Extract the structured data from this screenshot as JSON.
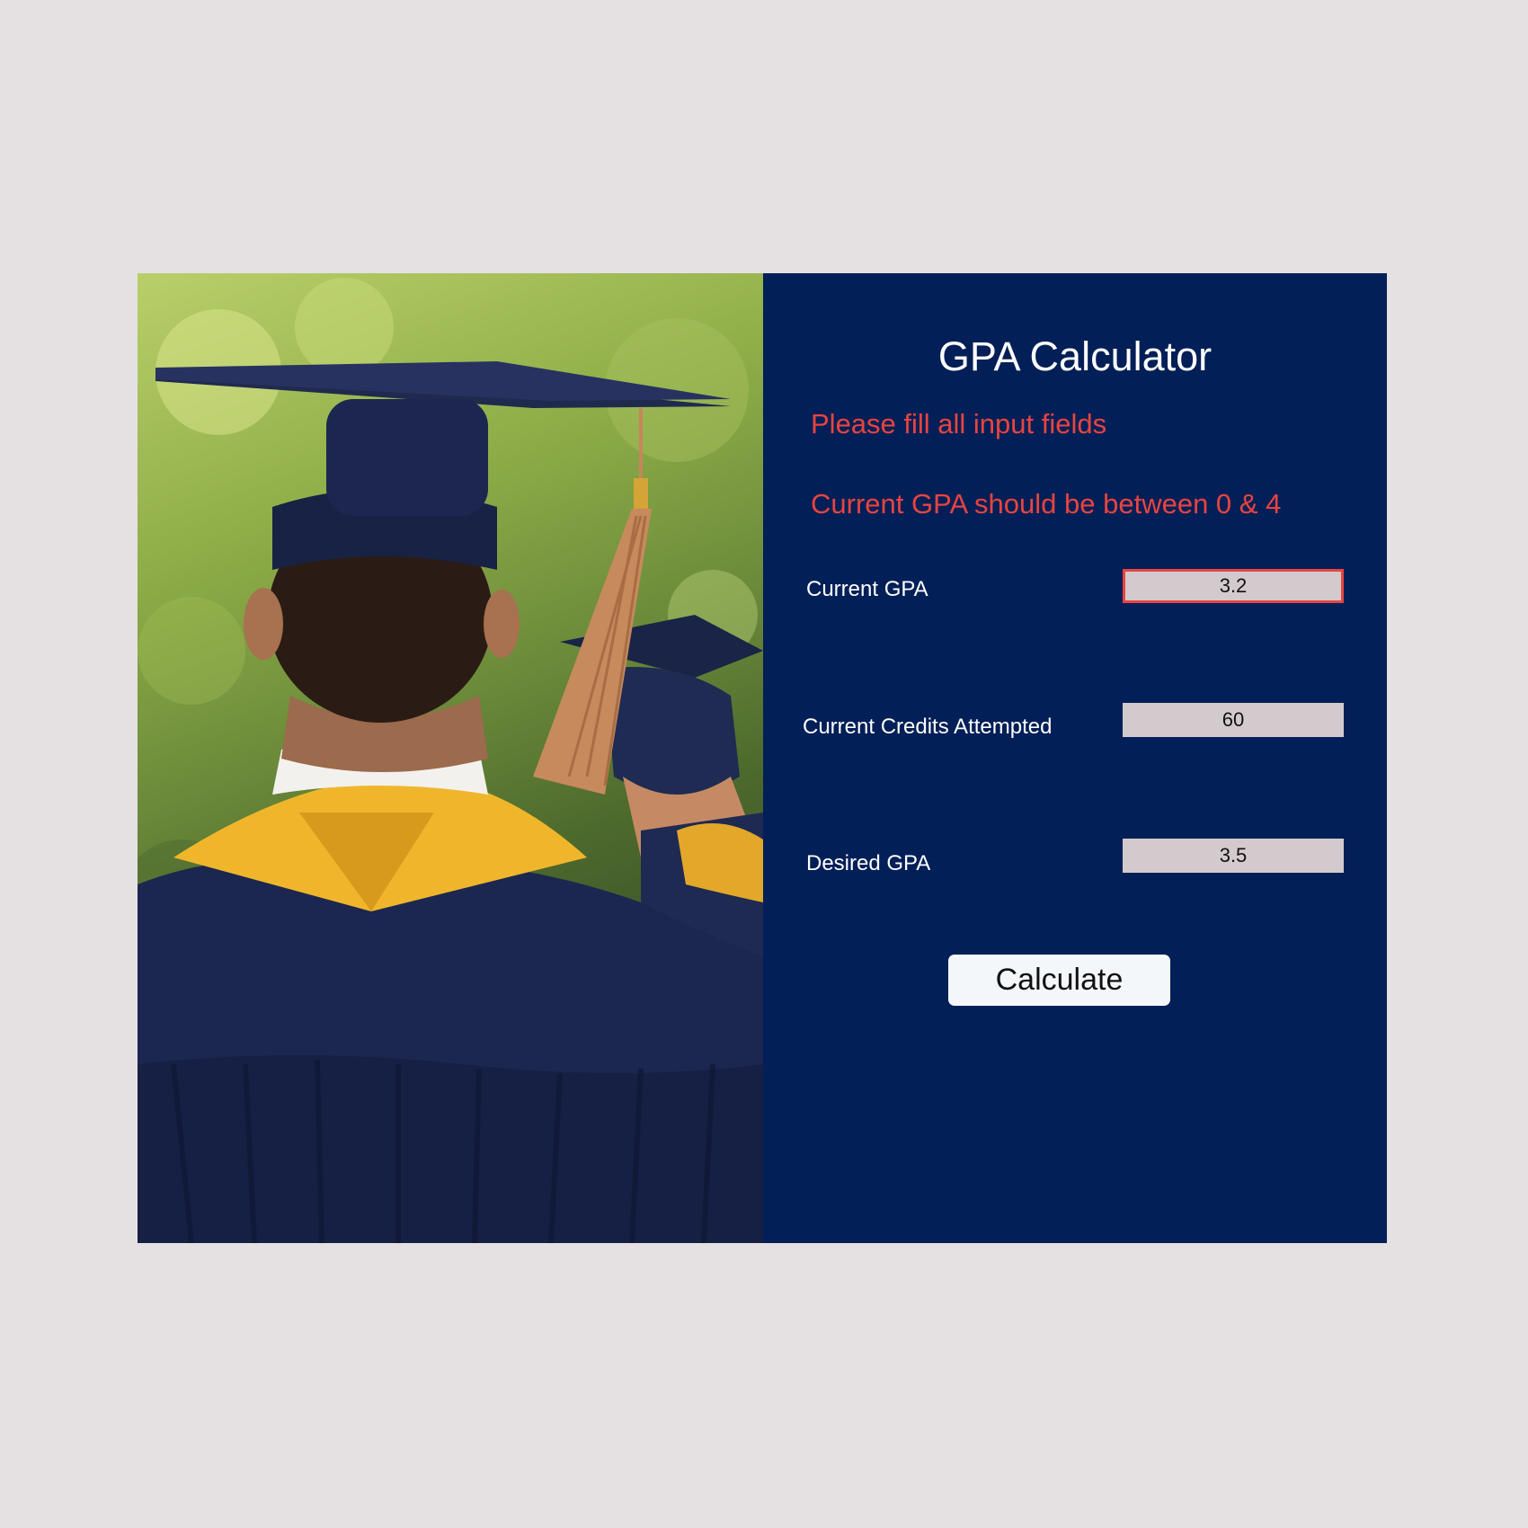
{
  "title": "GPA Calculator",
  "errors": {
    "fill_all": "Please fill all input fields",
    "gpa_range": "Current GPA should be between 0 & 4"
  },
  "fields": {
    "current_gpa": {
      "label": "Current GPA",
      "value": "3.2"
    },
    "current_credits": {
      "label": "Current Credits Attempted",
      "value": "60"
    },
    "desired_gpa": {
      "label": "Desired GPA",
      "value": "3.5"
    }
  },
  "button": {
    "label": "Calculate"
  },
  "colors": {
    "page_background": "#e5e0e2",
    "panel_background": "#021f57",
    "error_text": "#e8443f",
    "input_background": "#d3cacd",
    "button_background": "#f4f7fa"
  }
}
